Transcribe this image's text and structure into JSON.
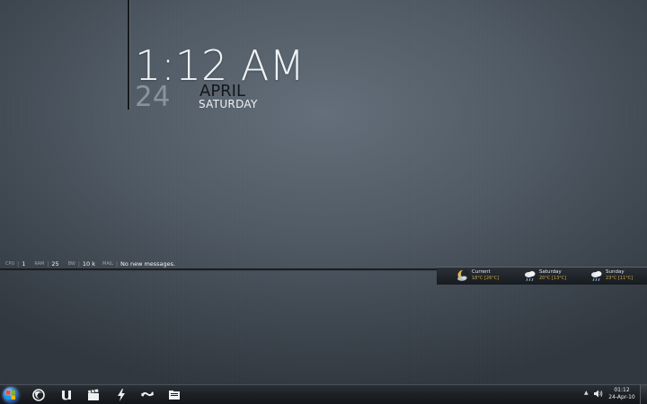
{
  "clock": {
    "time": "1:12 AM",
    "day": "24",
    "month": "APRIL",
    "weekday": "SATURDAY"
  },
  "status": {
    "cpu": {
      "label": "CPU",
      "value": "1"
    },
    "ram": {
      "label": "RAM",
      "value": "25"
    },
    "net": {
      "label": "BW",
      "value": "10 k"
    },
    "mail": {
      "label": "MAIL",
      "value": "No new messages."
    }
  },
  "weather": [
    {
      "label": "Current",
      "temp": "18°C [26°C]",
      "icon": "moon-cloud-icon"
    },
    {
      "label": "Saturday",
      "temp": "20°C [13°C]",
      "icon": "rain-cloud-icon"
    },
    {
      "label": "Sunday",
      "temp": "23°C [11°C]",
      "icon": "rain-cloud-icon"
    }
  ],
  "taskbar": {
    "pinned": [
      "start-orb",
      "firefox-icon",
      "utorrent-icon",
      "film-clapper-icon",
      "lightning-icon",
      "sync-icon",
      "folder-icon"
    ]
  },
  "tray": {
    "time": "01:12",
    "date": "24-Apr-10"
  },
  "colors": {
    "background": "#4f5963",
    "accent_temp": "#c9a64a",
    "taskbar": "#1b1f23"
  }
}
